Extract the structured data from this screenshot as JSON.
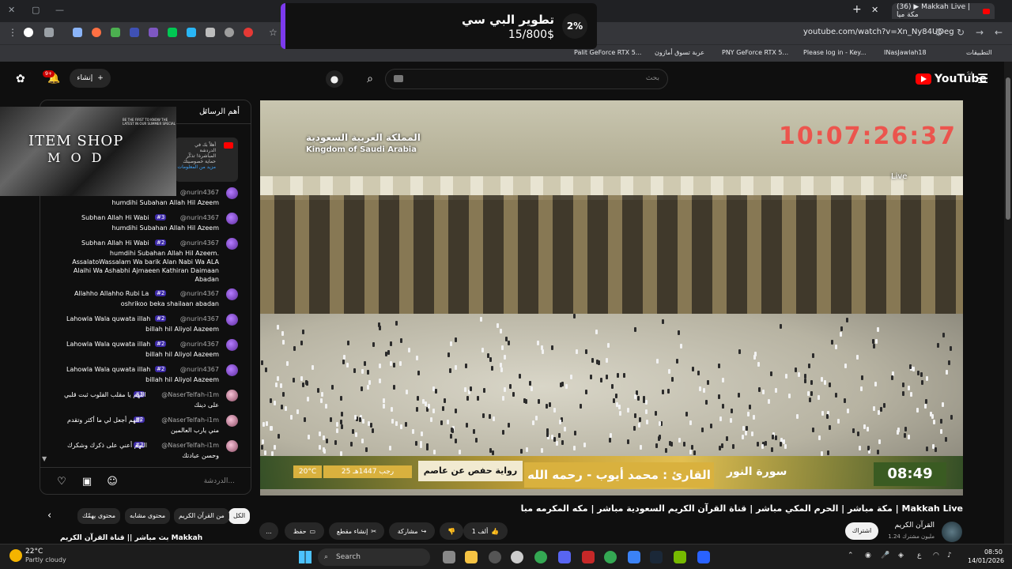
{
  "browser": {
    "active_tab_title": "(36) ▶ Makkah Live | مكة ميا",
    "url": "youtube.com/watch?v=Xn_Ny84UDeg",
    "bookmarks": [
      {
        "label": "التطبيقات"
      },
      {
        "label": "INasJawlah18"
      },
      {
        "label": "Please log in - Key..."
      },
      {
        "label": "PNY GeForce RTX 5..."
      },
      {
        "label": "عربة تسوق أمازون"
      },
      {
        "label": "Palit GeForce RTX 5..."
      }
    ]
  },
  "donation": {
    "title": "تطوير البي سي",
    "amount": "15/800$",
    "percent_label": "2%"
  },
  "header": {
    "logo_text": "YouTube",
    "region": "SA",
    "search_placeholder": "بحث",
    "create_label": "إنشاء",
    "notif_count": "9+"
  },
  "chat": {
    "title": "أهم الرسائل",
    "pinned_text": "أهلاً بك في الدردشة المباشرة! تذكّر حماية خصوصيتك",
    "pinned_more": "مزيد من المعلومات",
    "messages": [
      {
        "user": "@nurin4367",
        "badge": "",
        "side": "",
        "text": "humdihi Subahan Allah Hil Azeem"
      },
      {
        "user": "@nurin4367",
        "badge": "#3",
        "side": "Subhan Allah Hi Wabi",
        "text": "humdihi Subahan Allah Hil Azeem"
      },
      {
        "user": "@nurin4367",
        "badge": "#2",
        "side": "Subhan Allah Hi Wabi",
        "text": "humdihi Subahan Allah Hil Azeem. AssalatoWassalam Wa barik Alan Nabi Wa ALA Alaihi Wa Ashabhi Ajmaeen Kathiran Daimaan Abadan"
      },
      {
        "user": "@nurin4367",
        "badge": "#2",
        "side": "Allahho Allahho Rubi La",
        "text": "oshrikoo beka shailaan abadan"
      },
      {
        "user": "@nurin4367",
        "badge": "#2",
        "side": "Lahowla Wala quwata illah",
        "text": "billah hil Aliyol Aazeem"
      },
      {
        "user": "@nurin4367",
        "badge": "#2",
        "side": "Lahowla Wala quwata illah",
        "text": "billah hil Aliyol Aazeem"
      },
      {
        "user": "@nurin4367",
        "badge": "#2",
        "side": "Lahowla Wala quwata illah",
        "text": "billah hil Aliyol Aazeem"
      },
      {
        "user": "@NaserTelfah-i1m",
        "badge": "#3",
        "side": "اللهم يا مقلب القلوب ثبت قلبي",
        "text": "على دينك"
      },
      {
        "user": "@NaserTelfah-i1m",
        "badge": "#2",
        "side": "اللهم أجعل لي ما أكثر وتقدم",
        "text": "مني يارب العالمين"
      },
      {
        "user": "@NaserTelfah-i1m",
        "badge": "#2",
        "side": "اللهم أعني على ذكرك وشكرك",
        "text": "وحسن عبادتك"
      }
    ],
    "input_placeholder": "الدردشة..."
  },
  "overlay": {
    "mod_line1": "ITEM SHOP",
    "mod_line2": "M O D",
    "mod_small": "BE THE FIRST TO KNOW THE LATEST IN OUR SUMMER SPECIAL"
  },
  "video": {
    "ksa_ar": "المملكة العربية السعودية",
    "ksa_en": "Kingdom of Saudi Arabia",
    "time_overlay": "10:07:26:37",
    "live_label": "Live",
    "clock": "08:49",
    "surah": "سورة النور",
    "reader": "القارئ : محمد أيوب - رحمه الله",
    "riwaya": "رواية حفص عن عاصم",
    "hijri_date": "25 رجب 1447هـ",
    "temperature": "20°C"
  },
  "details": {
    "title": "مكة مباشر | الحرم المكي مباشر | قناة القرآن الكريم السعودية مباشر | مكه المكرمه مبا | Makkah Live",
    "channel_name": "القرآن الكريم",
    "subscribers": "1.24 مليون مشترك",
    "subscribe_label": "اشتراك",
    "like_count": "1 ألف",
    "share_label": "مشاركة",
    "clip_label": "إنشاء مقطع",
    "save_label": "حفظ",
    "more_label": "..."
  },
  "chips": [
    {
      "label": "الكل",
      "selected": true
    },
    {
      "label": "من القرآن الكريم",
      "selected": false
    },
    {
      "label": "محتوى مشابه",
      "selected": false
    },
    {
      "label": "محتوى يهمّك",
      "selected": false
    }
  ],
  "recommended": {
    "title": "بث مباشر || قناة القرآن الكريم Makkah"
  },
  "taskbar": {
    "temperature": "22°C",
    "condition": "Partly cloudy",
    "search_label": "Search",
    "time": "08:50",
    "date": "14/01/2026"
  }
}
